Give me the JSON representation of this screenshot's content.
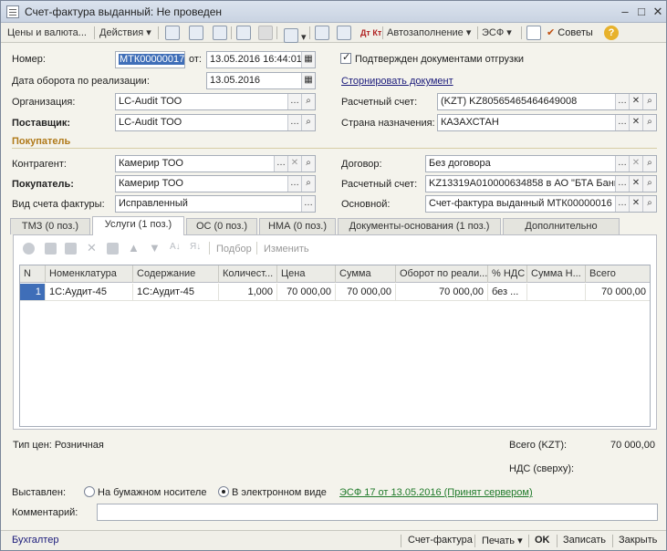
{
  "window": {
    "title": "Счет-фактура выданный: Не проведен"
  },
  "toolbar": {
    "prices": "Цены и валюта...",
    "actions": "Действия",
    "autofill": "Автозаполнение",
    "esf": "ЭСФ",
    "tips": "Советы",
    "dtkt": "Дт Кт"
  },
  "header": {
    "number_label": "Номер:",
    "number_value": "МТК00000017",
    "from_label": "от:",
    "date_value": "13.05.2016 16:44:01",
    "turnover_label": "Дата оборота по реализации:",
    "turnover_value": "13.05.2016",
    "confirmed_label": "Подтвержден документами отгрузки",
    "storno_link": "Сторнировать документ",
    "org_label": "Организация:",
    "org_value": "LC-Audit ТОО",
    "account_label": "Расчетный счет:",
    "account_value": "(KZT) KZ80565465464649008",
    "supplier_label": "Поставщик:",
    "supplier_value": "LC-Audit ТОО",
    "country_label": "Страна назначения:",
    "country_value": "КАЗАХСТАН"
  },
  "buyer": {
    "section_title": "Покупатель",
    "contractor_label": "Контрагент:",
    "contractor_value": "Камерир ТОО",
    "contract_label": "Договор:",
    "contract_value": "Без договора",
    "buyer_label": "Покупатель:",
    "buyer_value": "Камерир ТОО",
    "buyer_account_label": "Расчетный счет:",
    "buyer_account_value": "KZ13319A010000634858 в АО \"БТА Банк\"",
    "invoice_type_label": "Вид счета фактуры:",
    "invoice_type_value": "Исправленный",
    "basis_label": "Основной:",
    "basis_value": "Счет-фактура выданный МТК00000016 от"
  },
  "tabs": [
    {
      "label": "ТМЗ (0 поз.)"
    },
    {
      "label": "Услуги (1 поз.)"
    },
    {
      "label": "ОС (0 поз.)"
    },
    {
      "label": "НМА (0 поз.)"
    },
    {
      "label": "Документы-основания (1 поз.)"
    },
    {
      "label": "Дополнительно"
    }
  ],
  "grid_toolbar": {
    "select": "Подбор",
    "change": "Изменить"
  },
  "grid": {
    "columns": [
      "N",
      "Номенклатура",
      "Содержание",
      "Количест...",
      "Цена",
      "Сумма",
      "Оборот по реали...",
      "% НДС",
      "Сумма Н...",
      "Всего"
    ],
    "rows": [
      [
        "1",
        "1С:Аудит-45",
        "1С:Аудит-45",
        "1,000",
        "70 000,00",
        "70 000,00",
        "70 000,00",
        "без ...",
        "",
        "70 000,00"
      ]
    ]
  },
  "summary": {
    "price_type": "Тип цен: Розничная",
    "total_label": "Всего (KZT):",
    "total_value": "70 000,00",
    "vat_label": "НДС (сверху):"
  },
  "issued": {
    "label": "Выставлен:",
    "paper": "На бумажном носителе",
    "electronic": "В электронном виде",
    "esf_link": "ЭСФ 17 от 13.05.2016 (Принят сервером)"
  },
  "comment": {
    "label": "Комментарий:",
    "value": ""
  },
  "footer": {
    "accountant": "Бухгалтер",
    "invoice": "Счет-фактура",
    "print": "Печать",
    "ok": "OK",
    "save": "Записать",
    "close": "Закрыть"
  }
}
